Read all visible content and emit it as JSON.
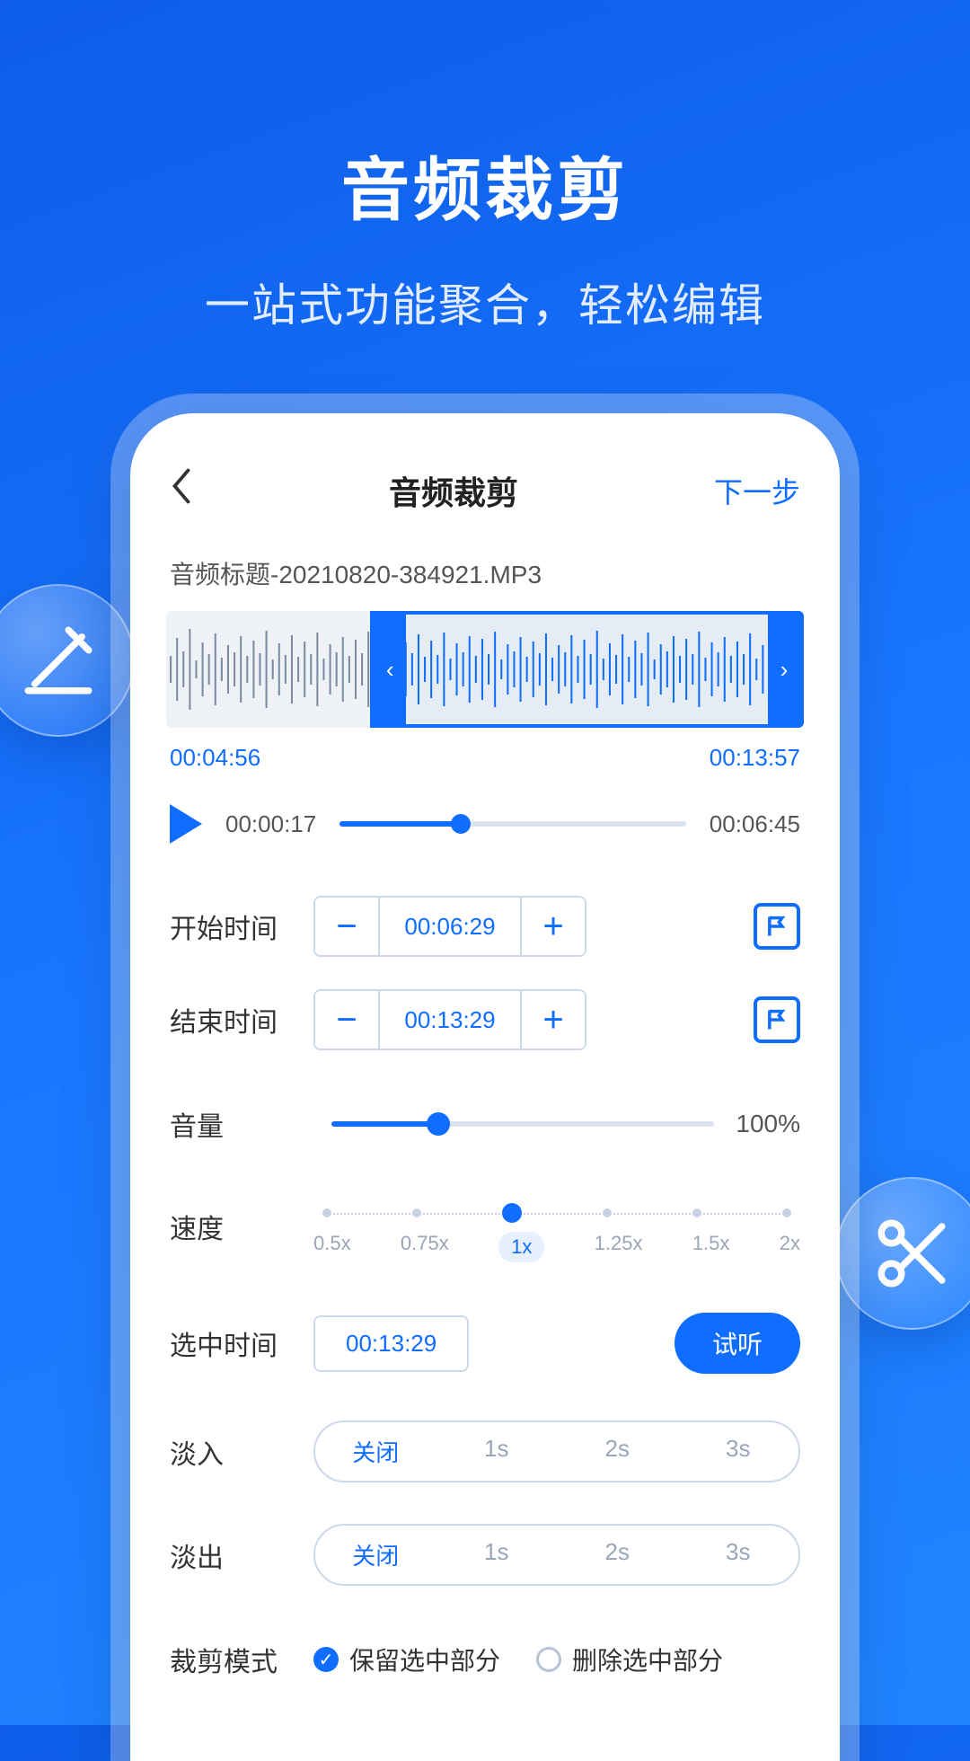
{
  "hero": {
    "title": "音频裁剪",
    "subtitle": "一站式功能聚合，轻松编辑"
  },
  "nav": {
    "title": "音频裁剪",
    "next": "下一步"
  },
  "file": {
    "name": "音频标题-20210820-384921.MP3"
  },
  "selection": {
    "start": "00:04:56",
    "end": "00:13:57"
  },
  "playback": {
    "current": "00:00:17",
    "total": "00:06:45"
  },
  "start_time": {
    "label": "开始时间",
    "value": "00:06:29"
  },
  "end_time": {
    "label": "结束时间",
    "value": "00:13:29"
  },
  "volume": {
    "label": "音量",
    "value": "100%"
  },
  "speed": {
    "label": "速度",
    "options": [
      "0.5x",
      "0.75x",
      "1x",
      "1.25x",
      "1.5x",
      "2x"
    ],
    "selected": "1x"
  },
  "selected_duration": {
    "label": "选中时间",
    "value": "00:13:29",
    "preview": "试听"
  },
  "fade_in": {
    "label": "淡入",
    "options": [
      "关闭",
      "1s",
      "2s",
      "3s"
    ],
    "selected": "关闭"
  },
  "fade_out": {
    "label": "淡出",
    "options": [
      "关闭",
      "1s",
      "2s",
      "3s"
    ],
    "selected": "关闭"
  },
  "trim_mode": {
    "label": "裁剪模式",
    "keep": "保留选中部分",
    "delete": "删除选中部分"
  }
}
